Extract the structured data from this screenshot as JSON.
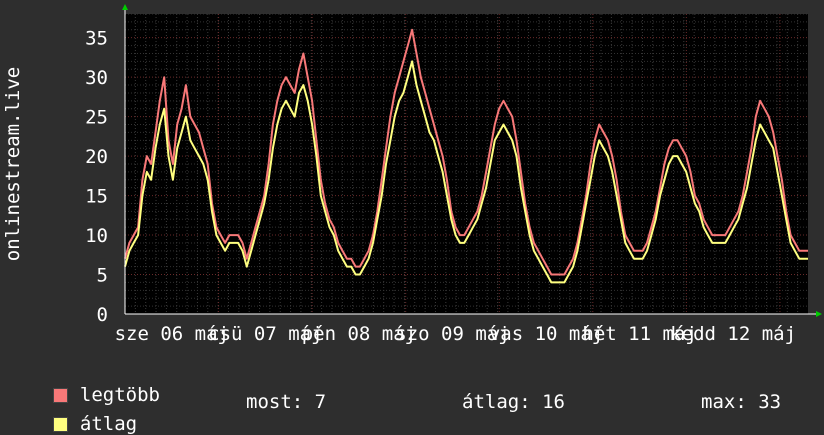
{
  "chart_data": {
    "type": "line",
    "ylabel": "onlinestream.live",
    "ylim": [
      0,
      38
    ],
    "yticks": [
      0,
      5,
      10,
      15,
      20,
      25,
      30,
      35
    ],
    "x_tick_labels": [
      "sze 06 máj",
      "csü 07 máj",
      "pén 08 máj",
      "szo 09 máj",
      "vas 10 máj",
      "hét 11 máj",
      "kedd 12 máj"
    ],
    "grid": true,
    "background": "#000000",
    "series": [
      {
        "name": "legtöbb",
        "color": "#f87878",
        "values": [
          7,
          9,
          10,
          11,
          17,
          20,
          19,
          23,
          27,
          30,
          22,
          19,
          24,
          26,
          29,
          25,
          24,
          23,
          21,
          19,
          14,
          11,
          10,
          9,
          10,
          10,
          10,
          9,
          7,
          9,
          11,
          13,
          15,
          19,
          24,
          27,
          29,
          30,
          29,
          28,
          31,
          33,
          30,
          27,
          22,
          17,
          14,
          12,
          11,
          9,
          8,
          7,
          7,
          6,
          6,
          7,
          8,
          10,
          13,
          17,
          21,
          25,
          28,
          30,
          32,
          34,
          36,
          33,
          30,
          28,
          26,
          24,
          22,
          20,
          17,
          13,
          11,
          10,
          10,
          11,
          12,
          13,
          15,
          18,
          21,
          24,
          26,
          27,
          26,
          25,
          22,
          18,
          14,
          11,
          9,
          8,
          7,
          6,
          5,
          5,
          5,
          5,
          6,
          7,
          9,
          12,
          15,
          19,
          22,
          24,
          23,
          22,
          20,
          17,
          13,
          10,
          9,
          8,
          8,
          8,
          9,
          11,
          13,
          16,
          19,
          21,
          22,
          22,
          21,
          20,
          18,
          15,
          14,
          12,
          11,
          10,
          10,
          10,
          10,
          11,
          12,
          13,
          15,
          18,
          21,
          25,
          27,
          26,
          25,
          23,
          20,
          17,
          13,
          10,
          9,
          8,
          8,
          8
        ],
        "style": "line"
      },
      {
        "name": "átlag",
        "color": "#ffff80",
        "values": [
          6,
          8,
          9,
          10,
          15,
          18,
          17,
          21,
          24,
          26,
          20,
          17,
          21,
          23,
          25,
          22,
          21,
          20,
          19,
          17,
          13,
          10,
          9,
          8,
          9,
          9,
          9,
          8,
          6,
          8,
          10,
          12,
          14,
          17,
          21,
          24,
          26,
          27,
          26,
          25,
          28,
          29,
          27,
          24,
          20,
          15,
          13,
          11,
          10,
          8,
          7,
          6,
          6,
          5,
          5,
          6,
          7,
          9,
          12,
          15,
          19,
          22,
          25,
          27,
          28,
          30,
          32,
          29,
          27,
          25,
          23,
          22,
          20,
          18,
          15,
          12,
          10,
          9,
          9,
          10,
          11,
          12,
          14,
          16,
          19,
          22,
          23,
          24,
          23,
          22,
          20,
          16,
          13,
          10,
          8,
          7,
          6,
          5,
          4,
          4,
          4,
          4,
          5,
          6,
          8,
          11,
          14,
          17,
          20,
          22,
          21,
          20,
          18,
          15,
          12,
          9,
          8,
          7,
          7,
          7,
          8,
          10,
          12,
          15,
          17,
          19,
          20,
          20,
          19,
          18,
          16,
          14,
          13,
          11,
          10,
          9,
          9,
          9,
          9,
          10,
          11,
          12,
          14,
          16,
          19,
          22,
          24,
          23,
          22,
          21,
          18,
          15,
          12,
          9,
          8,
          7,
          7,
          7
        ],
        "style": "line"
      }
    ],
    "legend": "bottom-left"
  },
  "legend": {
    "items": [
      {
        "label": "legtöbb",
        "color": "#f87878"
      },
      {
        "label": "átlag",
        "color": "#ffff80"
      }
    ]
  },
  "stats": {
    "now": "most: 7",
    "avg": "átlag: 16",
    "max": "max: 33"
  }
}
